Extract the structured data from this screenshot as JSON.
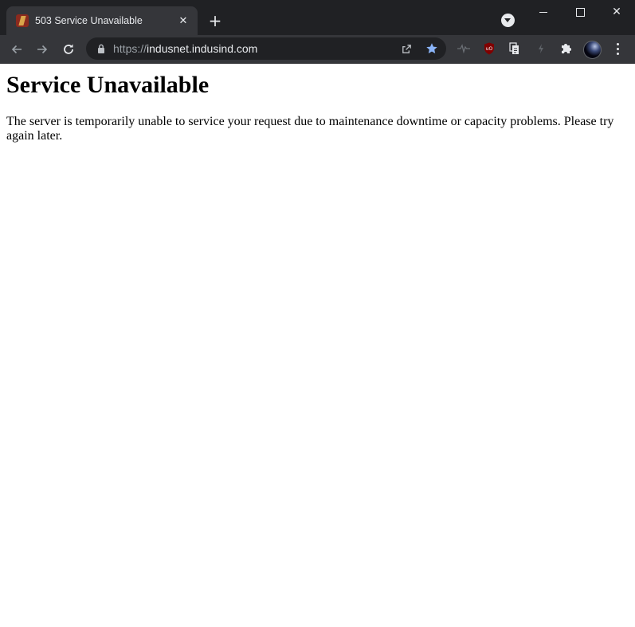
{
  "browser": {
    "tab": {
      "title": "503 Service Unavailable",
      "close_glyph": "✕"
    },
    "new_tab_glyph": "+",
    "window_close_glyph": "✕",
    "address": {
      "scheme": "https://",
      "host": "indusnet.indusind.com"
    },
    "icons": {
      "favicon": "indusind-favicon",
      "lock": "lock-icon",
      "share": "share-icon",
      "star": "bookmark-star-icon",
      "extensions": [
        "pulse-extension-icon",
        "ublock-origin-icon",
        "docs-extension-icon",
        "bolt-extension-icon",
        "puzzle-extensions-icon"
      ],
      "avatar": "profile-avatar",
      "menu": "kebab-menu-icon"
    },
    "colors": {
      "star": "#8ab4f8",
      "ublock": "#800000"
    }
  },
  "page": {
    "heading": "Service Unavailable",
    "message": "The server is temporarily unable to service your request due to maintenance downtime or capacity problems. Please try again later."
  }
}
